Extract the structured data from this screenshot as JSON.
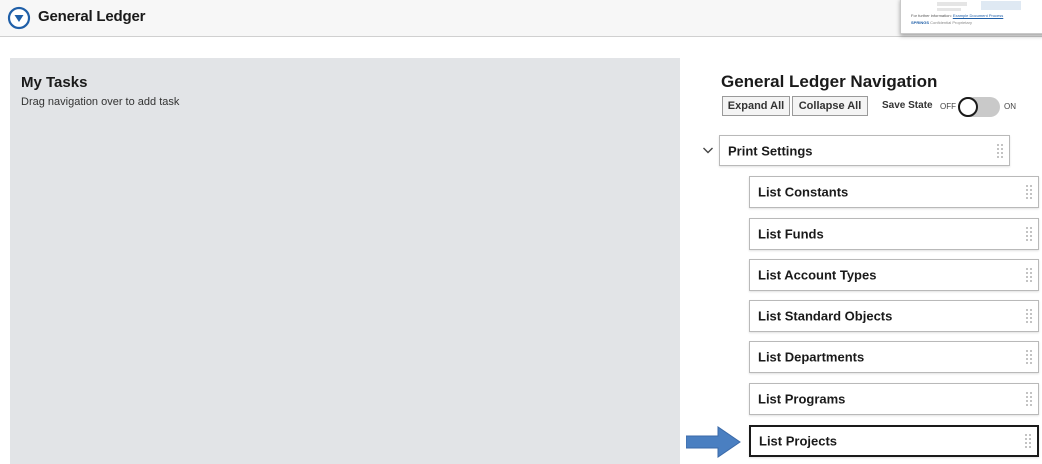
{
  "header": {
    "title": "General Ledger",
    "logo_icon": "circle-chevron-down-icon",
    "brand_color": "#1f5fa8"
  },
  "thumbnail": {
    "text_prefix": "For further information:",
    "link_text": "Example Document Process",
    "brand": "SPRINGS",
    "brand_sub": "Confidential Proprietary"
  },
  "my_tasks": {
    "title": "My Tasks",
    "subtitle": "Drag navigation over to add task"
  },
  "navigation": {
    "title": "General Ledger Navigation",
    "expand_all": "Expand All",
    "collapse_all": "Collapse All",
    "save_state_label": "Save State",
    "toggle_off": "OFF",
    "toggle_on": "ON",
    "save_state_on": false,
    "parent": {
      "label": "Print Settings",
      "expanded": true
    },
    "items": [
      {
        "label": "List Constants"
      },
      {
        "label": "List Funds"
      },
      {
        "label": "List Account Types"
      },
      {
        "label": "List Standard Objects"
      },
      {
        "label": "List Departments"
      },
      {
        "label": "List Programs"
      },
      {
        "label": "List Projects",
        "selected": true
      }
    ]
  },
  "annotation": {
    "arrow_color": "#4a7fc1",
    "arrow_icon": "arrow-right-icon"
  }
}
